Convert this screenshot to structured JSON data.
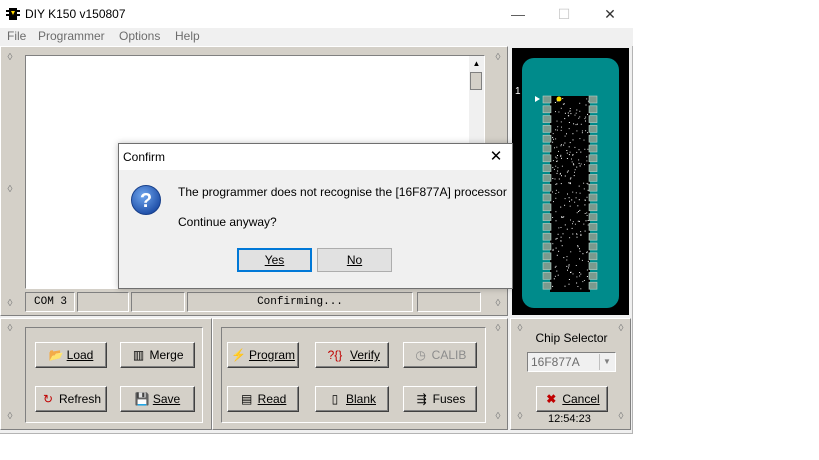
{
  "window": {
    "title": "DIY K150 v150807",
    "minimize_glyph": "—",
    "maximize_glyph": "☐",
    "close_glyph": "✕"
  },
  "menu": [
    "File",
    "Programmer",
    "Options",
    "Help"
  ],
  "status_bar": {
    "port": "COM 3",
    "message": "Confirming..."
  },
  "file_buttons": {
    "load": "Load",
    "merge": "Merge",
    "refresh": "Refresh",
    "save": "Save"
  },
  "program_buttons": {
    "program": "Program",
    "verify": "Verify",
    "calib": "CALIB",
    "read": "Read",
    "blank": "Blank",
    "fuses": "Fuses"
  },
  "chip_selector": {
    "label": "Chip Selector",
    "selected": "16F877A",
    "cancel": "Cancel",
    "time": "12:54:23",
    "pin_label": "1"
  },
  "dialog": {
    "title": "Confirm",
    "message": "The programmer does not recognise the [16F877A] processor",
    "question": "Continue anyway?",
    "yes": "Yes",
    "no": "No",
    "icon": "question-icon"
  },
  "colors": {
    "socket_teal": "#008b8b",
    "panel_gray": "#d4d0c8",
    "dialog_accent": "#0078d7",
    "icon_blue": "#1f5fbf"
  }
}
